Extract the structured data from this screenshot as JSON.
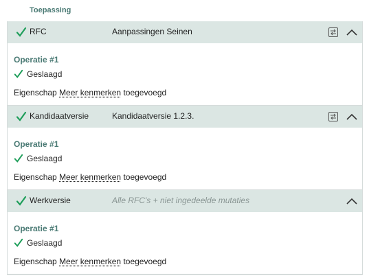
{
  "section": {
    "title": "Toepassing"
  },
  "panels": [
    {
      "name": "RFC",
      "description": "Aanpassingen Seinen",
      "status_muted": false,
      "has_compare": true,
      "operation": {
        "title": "Operatie #1",
        "status": "Geslaagd",
        "line_prefix": "Eigenschap",
        "line_link": "Meer kenmerken",
        "line_suffix": "toegevoegd"
      }
    },
    {
      "name": "Kandidaatversie",
      "description": "Kandidaatversie 1.2.3.",
      "status_muted": false,
      "has_compare": true,
      "operation": {
        "title": "Operatie #1",
        "status": "Geslaagd",
        "line_prefix": "Eigenschap",
        "line_link": "Meer kenmerken",
        "line_suffix": "toegevoegd"
      }
    },
    {
      "name": "Werkversie",
      "description": "Alle RFC's + niet ingedeelde mutaties",
      "status_muted": true,
      "has_compare": false,
      "operation": {
        "title": "Operatie #1",
        "status": "Geslaagd",
        "line_prefix": "Eigenschap",
        "line_link": "Meer kenmerken",
        "line_suffix": "toegevoegd"
      }
    }
  ],
  "colors": {
    "success": "#1e9e5a",
    "accent": "#4a7a74",
    "header_bg": "#dbe6e3"
  },
  "icons": {
    "success": "check-icon",
    "compare": "compare-icon",
    "collapse": "chevron-up-icon"
  }
}
